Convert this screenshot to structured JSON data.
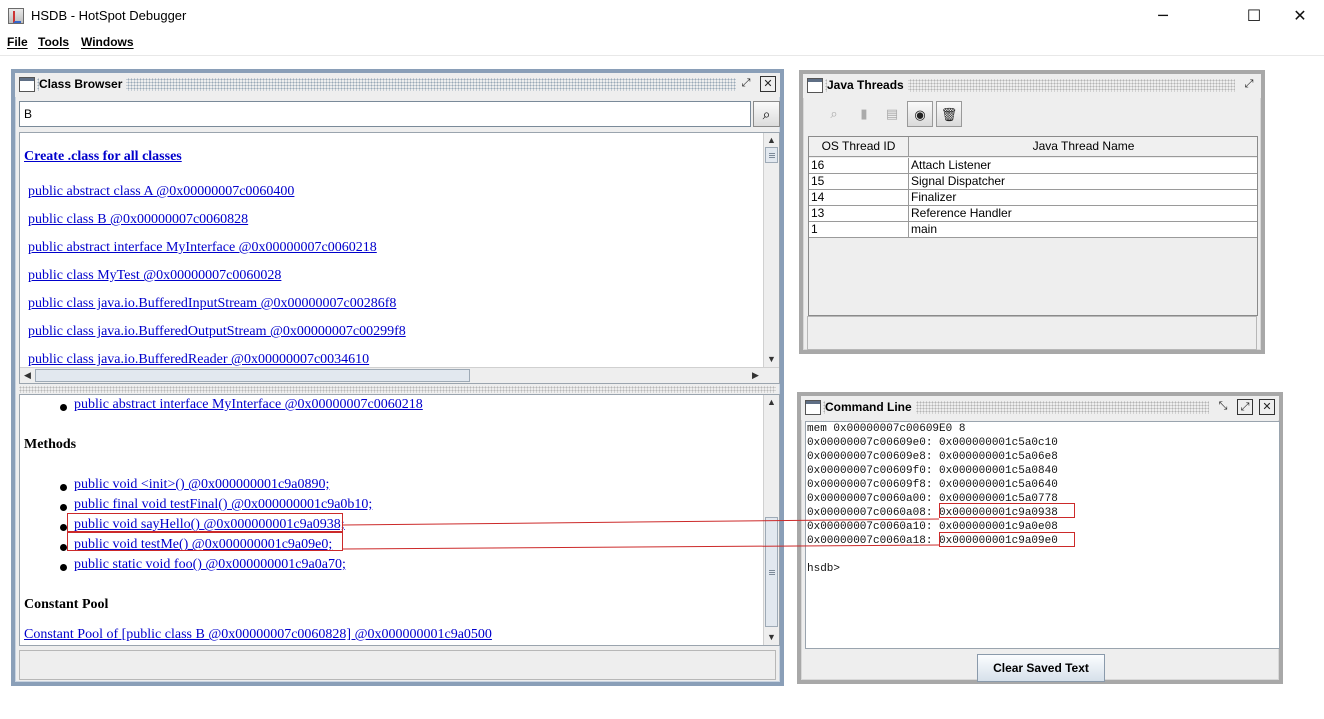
{
  "window": {
    "title": "HSDB - HotSpot Debugger",
    "minimize_glyph": "─",
    "maximize_glyph": "☐",
    "close_glyph": "✕"
  },
  "menu": {
    "file": "File",
    "tools": "Tools",
    "windows": "Windows"
  },
  "class_browser": {
    "title": "Class Browser",
    "search_value": "B",
    "find_icon": "binoculars-icon",
    "create_link": "Create .class for all classes",
    "classes": [
      "public abstract class A @0x00000007c0060400",
      "public class B @0x00000007c0060828",
      "public abstract interface MyInterface @0x00000007c0060218",
      "public class MyTest @0x00000007c0060028",
      "public class java.io.BufferedInputStream @0x00000007c00286f8",
      "public class java.io.BufferedOutputStream @0x00000007c00299f8",
      "public class java.io.BufferedReader @0x00000007c0034610"
    ],
    "detail": {
      "interface_item": "public abstract interface MyInterface @0x00000007c0060218",
      "methods_heading": "Methods",
      "methods": [
        "public void <init>() @0x000000001c9a0890;",
        "public final void testFinal() @0x000000001c9a0b10;",
        "public void sayHello() @0x000000001c9a0938;",
        "public void testMe() @0x000000001c9a09e0;",
        "public static void foo() @0x000000001c9a0a70;"
      ],
      "constant_pool_heading": "Constant Pool",
      "constant_pool_link": "Constant Pool of [public class B @0x00000007c0060828] @0x000000001c9a0500"
    }
  },
  "java_threads": {
    "title": "Java Threads",
    "columns": [
      "OS Thread ID",
      "Java Thread Name"
    ],
    "rows": [
      {
        "id": "16",
        "name": "Attach Listener"
      },
      {
        "id": "15",
        "name": "Signal Dispatcher"
      },
      {
        "id": "14",
        "name": "Finalizer"
      },
      {
        "id": "13",
        "name": "Reference Handler"
      },
      {
        "id": "1",
        "name": "main"
      }
    ]
  },
  "command_line": {
    "title": "Command Line",
    "lines": [
      "mem 0x00000007c00609E0 8",
      "0x00000007c00609e0: 0x000000001c5a0c10",
      "0x00000007c00609e8: 0x000000001c5a06e8",
      "0x00000007c00609f0: 0x000000001c5a0840",
      "0x00000007c00609f8: 0x000000001c5a0640",
      "0x00000007c0060a00: 0x000000001c5a0778",
      "0x00000007c0060a08: 0x000000001c9a0938",
      "0x00000007c0060a10: 0x000000001c9a0e08",
      "0x00000007c0060a18: 0x000000001c9a09e0",
      "",
      "hsdb>"
    ],
    "clear_button": "Clear Saved Text"
  }
}
